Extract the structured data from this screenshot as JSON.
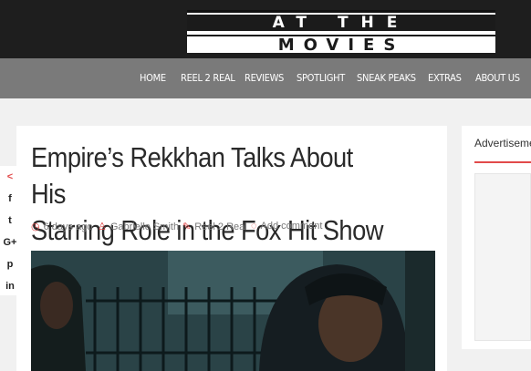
{
  "logo": {
    "line1": "AT THE",
    "line2": "MOVIES"
  },
  "nav": {
    "items": [
      {
        "label": "HOME"
      },
      {
        "label": "REEL 2 REAL"
      },
      {
        "label": "REVIEWS"
      },
      {
        "label": "SPOTLIGHT"
      },
      {
        "label": "SNEAK PEAKS"
      },
      {
        "label": "EXTRAS"
      },
      {
        "label": "ABOUT US"
      }
    ]
  },
  "article": {
    "title_line1": "Empire’s Rekkhan Talks About His",
    "title_line2": "Starring Role in the Fox Hit Show",
    "time": "6 days ago",
    "author": "Gabrielle Smith",
    "category": "Reel 2 Real",
    "comment": "Add comment"
  },
  "share": {
    "items": [
      {
        "label": "<",
        "icon": "share-icon"
      },
      {
        "label": "f",
        "icon": "facebook-icon"
      },
      {
        "label": "t",
        "icon": "twitter-icon"
      },
      {
        "label": "G+",
        "icon": "google-plus-icon"
      },
      {
        "label": "p",
        "icon": "pinterest-icon"
      },
      {
        "label": "in",
        "icon": "linkedin-icon"
      }
    ]
  },
  "sidebar": {
    "title": "Advertisement"
  },
  "colors": {
    "accent": "#e24a4a",
    "nav_bg": "#7a7a7a",
    "top_bg": "#1e1e1e"
  }
}
